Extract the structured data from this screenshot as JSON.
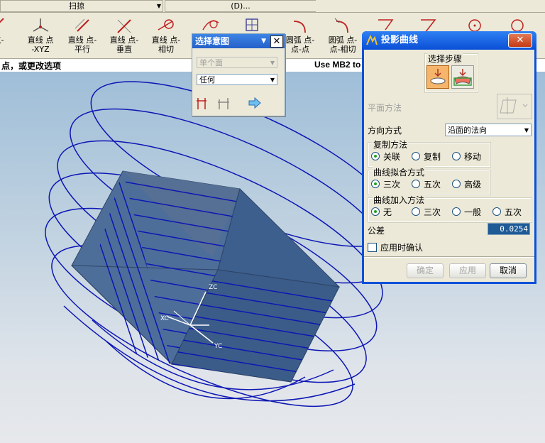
{
  "menu": {
    "scan_combo": "扫掠",
    "d_combo": "(D)..."
  },
  "toolbar": {
    "items": [
      {
        "label1": "点-",
        "label2": ""
      },
      {
        "label1": "直线 点",
        "label2": "-XYZ"
      },
      {
        "label1": "直线 点-",
        "label2": "平行"
      },
      {
        "label1": "直线 点-",
        "label2": "垂直"
      },
      {
        "label1": "直线 点-",
        "label2": "相切"
      },
      {
        "label1": "圆弧 点-",
        "label2": "点-点"
      },
      {
        "label1": "圆弧 点-",
        "label2": "点-相切"
      }
    ]
  },
  "status": {
    "left": "点，或更改选项",
    "right": "Use MB2 to"
  },
  "select_dialog": {
    "title": "选择意图",
    "filter_value": "单个面",
    "mode_value": "任何"
  },
  "proj_dialog": {
    "title": "投影曲线",
    "steps_label": "选择步骤",
    "plane_method_label": "平面方法",
    "direction_label": "方向方式",
    "direction_value": "沿面的法向",
    "copy_group": {
      "label": "复制方法",
      "options": [
        "关联",
        "复制",
        "移动"
      ],
      "selected": 0
    },
    "fit_group": {
      "label": "曲线拟合方式",
      "options": [
        "三次",
        "五次",
        "高级"
      ],
      "selected": 0
    },
    "join_group": {
      "label": "曲线加入方法",
      "options": [
        "无",
        "三次",
        "一般",
        "五次"
      ],
      "selected": 0
    },
    "tolerance_label": "公差",
    "tolerance_value": "0.0254",
    "confirm_on_apply_label": "应用时确认",
    "ok_label": "确定",
    "apply_label": "应用",
    "cancel_label": "取消"
  },
  "viewport": {
    "axis_z": "ZC",
    "axis_x": "XC",
    "axis_y": "YC"
  },
  "colors": {
    "curve": "#0d16b4",
    "box": "#3d5f8e",
    "title_blue": "#0a50d8"
  }
}
